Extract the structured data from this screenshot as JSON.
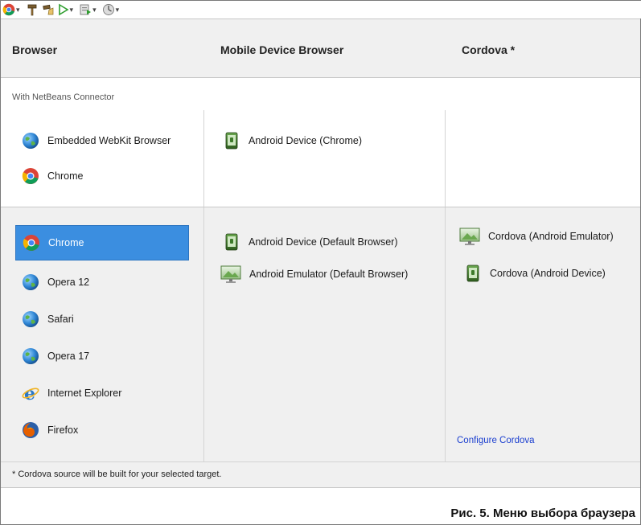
{
  "toolbar": {
    "icons": [
      "chrome-icon",
      "hammer-icon",
      "broom-icon",
      "run-icon",
      "debug-icon",
      "profile-icon"
    ]
  },
  "headers": {
    "browser": "Browser",
    "mobile": "Mobile Device Browser",
    "cordova": "Cordova *"
  },
  "connector_label": "With NetBeans Connector",
  "connector_browsers": [
    {
      "label": "Embedded WebKit Browser",
      "icon": "globe-icon"
    },
    {
      "label": "Chrome",
      "icon": "chrome-icon"
    }
  ],
  "connector_mobile": [
    {
      "label": "Android Device (Chrome)",
      "icon": "android-device-icon"
    }
  ],
  "browsers": [
    {
      "label": "Chrome",
      "icon": "chrome-icon",
      "selected": true
    },
    {
      "label": "Opera 12",
      "icon": "globe-icon"
    },
    {
      "label": "Safari",
      "icon": "globe-icon"
    },
    {
      "label": "Opera 17",
      "icon": "globe-icon"
    },
    {
      "label": "Internet Explorer",
      "icon": "ie-icon"
    },
    {
      "label": "Firefox",
      "icon": "firefox-icon"
    }
  ],
  "mobile": [
    {
      "label": "Android Device (Default Browser)",
      "icon": "android-device-icon"
    },
    {
      "label": "Android Emulator (Default Browser)",
      "icon": "emulator-icon"
    }
  ],
  "cordova": [
    {
      "label": "Cordova (Android Emulator)",
      "icon": "emulator-icon"
    },
    {
      "label": "Cordova (Android Device)",
      "icon": "android-device-icon"
    }
  ],
  "configure_link": "Configure Cordova",
  "footnote": "* Cordova source will be built for your selected target.",
  "caption": "Рис. 5. Меню выбора браузера",
  "colors": {
    "selected": "#3b8ee0",
    "link": "#1a3ecf",
    "panel": "#f0f0f0"
  }
}
